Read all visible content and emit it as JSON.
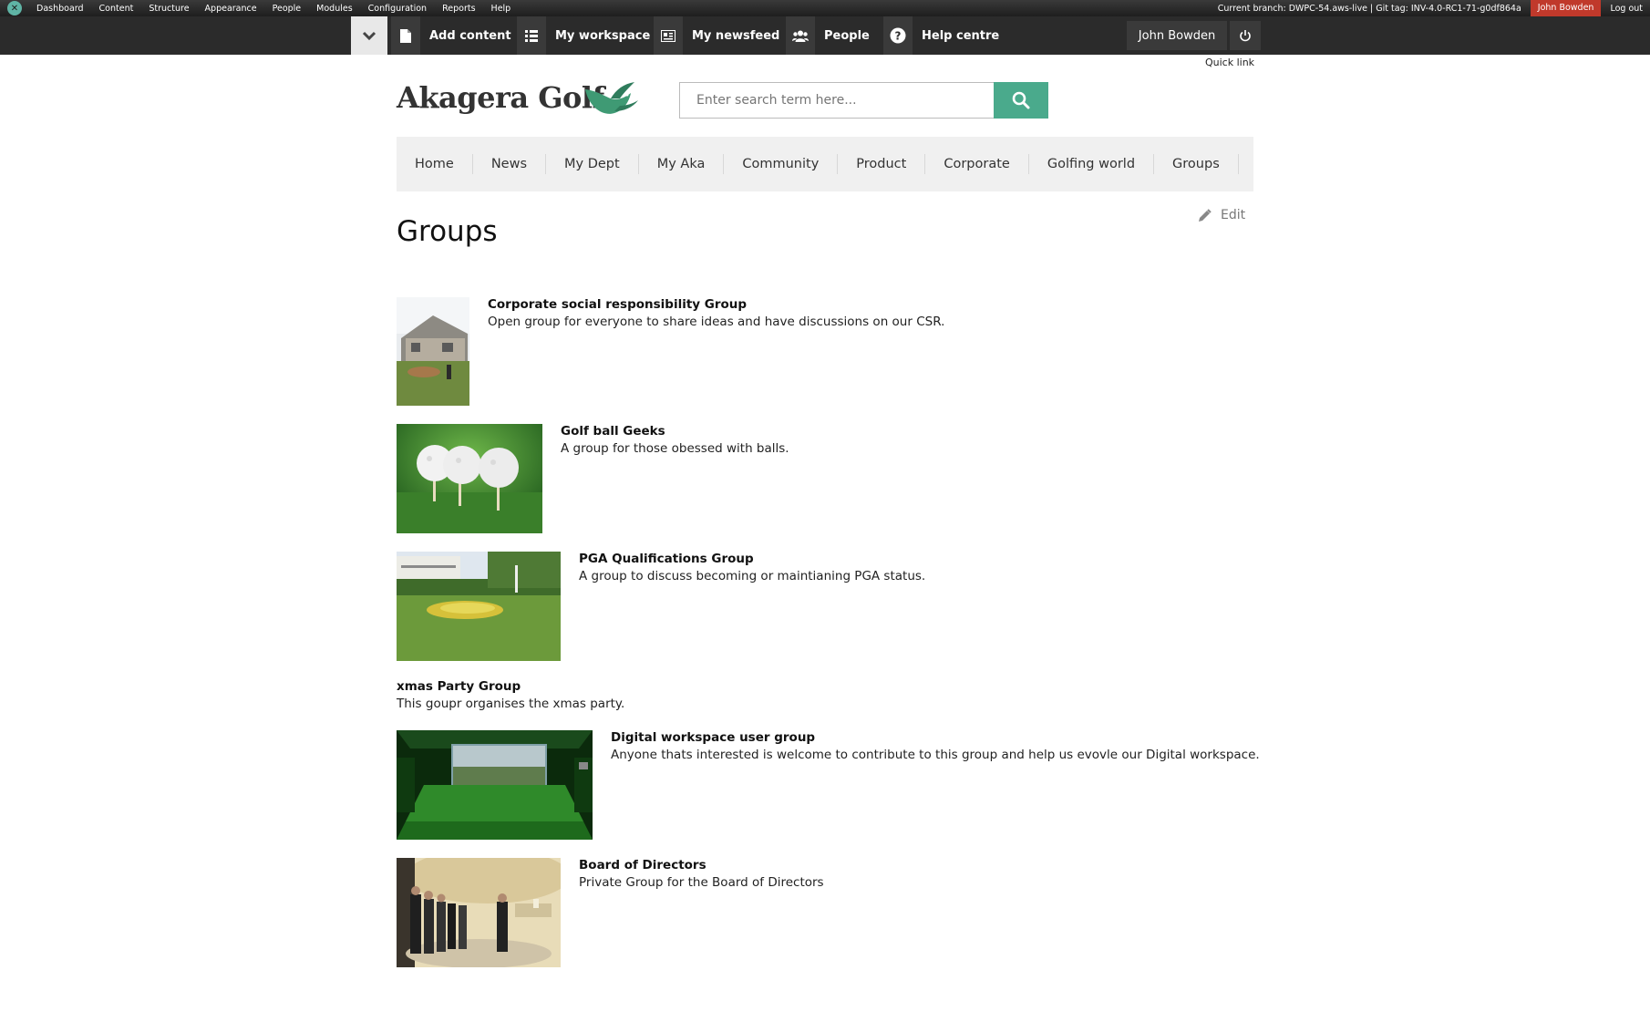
{
  "admin_bar": {
    "menu": [
      "Dashboard",
      "Content",
      "Structure",
      "Appearance",
      "People",
      "Modules",
      "Configuration",
      "Reports",
      "Help"
    ],
    "branch_info": "Current branch: DWPC-54.aws-live | Git tag: INV-4.0-RC1-71-g0df864a",
    "user": "John Bowden",
    "logout": "Log out"
  },
  "workspace_bar": {
    "add_content": "Add content",
    "my_workspace": "My workspace",
    "my_newsfeed": "My newsfeed",
    "people": "People",
    "help_centre": "Help centre",
    "user": "John Bowden"
  },
  "quick_link": "Quick link",
  "site": {
    "name": "Akagera Golf",
    "search_placeholder": "Enter search term here..."
  },
  "nav": [
    "Home",
    "News",
    "My Dept",
    "My Aka",
    "Community",
    "Product",
    "Corporate",
    "Golfing world",
    "Groups"
  ],
  "page": {
    "title": "Groups",
    "edit": "Edit"
  },
  "groups": [
    {
      "title": "Corporate social responsibility Group",
      "description": "Open group for everyone to share ideas and have discussions on our CSR."
    },
    {
      "title": "Golf ball Geeks",
      "description": "A group for those obessed with balls."
    },
    {
      "title": "PGA Qualifications Group",
      "description": "A group to discuss becoming or maintianing PGA status."
    },
    {
      "title": "xmas Party Group",
      "description": "This goupr organises the xmas party."
    },
    {
      "title": "Digital workspace user group",
      "description": "Anyone thats interested is welcome to contribute to this group and help us evovle our Digital workspace."
    },
    {
      "title": "Board of Directors",
      "description": "Private Group for the Board of Directors"
    }
  ],
  "colors": {
    "accent": "#4aaa8c",
    "admin_user_bg": "#c0392b",
    "toolbar_bg": "#2b2b2b"
  }
}
